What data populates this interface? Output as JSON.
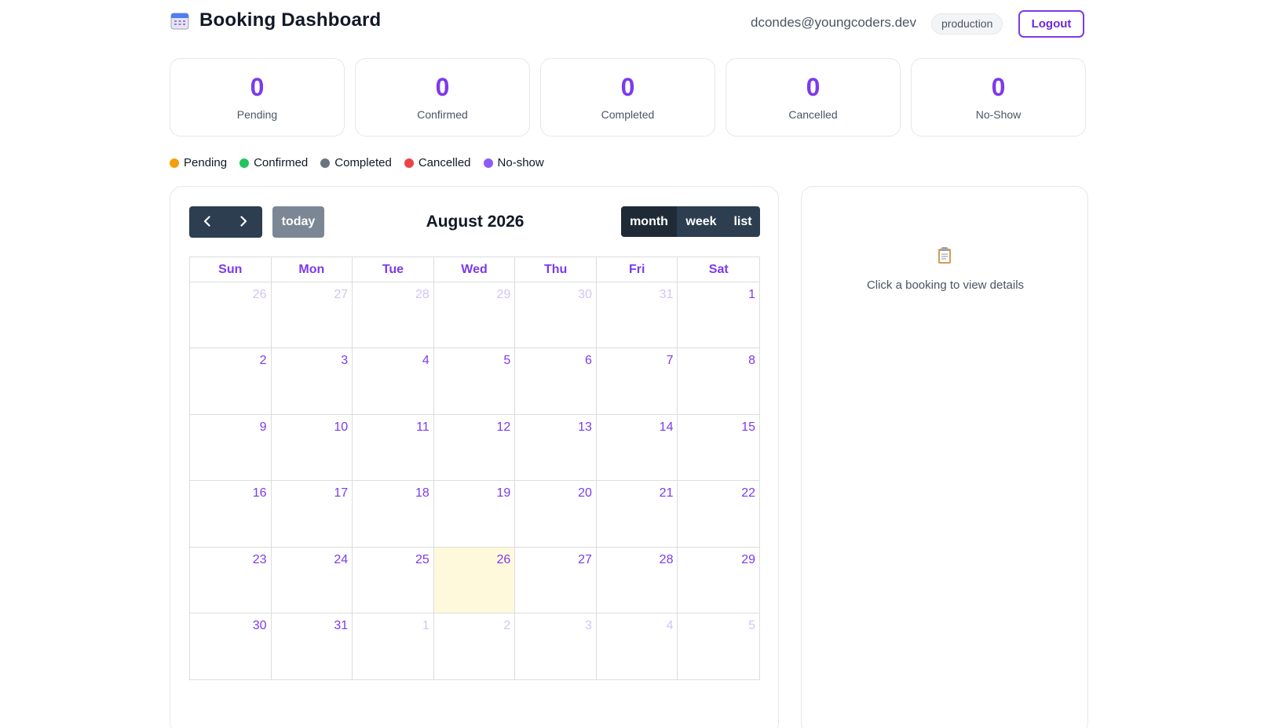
{
  "header": {
    "title": "Booking Dashboard",
    "logo_icon": "calendar-icon",
    "user_email": "dcondes@youngcoders.dev",
    "env_badge": "production",
    "logout_label": "Logout"
  },
  "stats": [
    {
      "value": "0",
      "label": "Pending"
    },
    {
      "value": "0",
      "label": "Confirmed"
    },
    {
      "value": "0",
      "label": "Completed"
    },
    {
      "value": "0",
      "label": "Cancelled"
    },
    {
      "value": "0",
      "label": "No-Show"
    }
  ],
  "legend": [
    {
      "label": "Pending",
      "color": "#f59e0b"
    },
    {
      "label": "Confirmed",
      "color": "#22c55e"
    },
    {
      "label": "Completed",
      "color": "#6b7280"
    },
    {
      "label": "Cancelled",
      "color": "#ef4444"
    },
    {
      "label": "No-show",
      "color": "#8b5cf6"
    }
  ],
  "calendar": {
    "title": "August 2026",
    "today_label": "today",
    "views": {
      "month": "month",
      "week": "week",
      "list": "list"
    },
    "active_view": "month",
    "weekdays": [
      "Sun",
      "Mon",
      "Tue",
      "Wed",
      "Thu",
      "Fri",
      "Sat"
    ],
    "weeks": [
      [
        {
          "d": "26",
          "m": true
        },
        {
          "d": "27",
          "m": true
        },
        {
          "d": "28",
          "m": true
        },
        {
          "d": "29",
          "m": true
        },
        {
          "d": "30",
          "m": true
        },
        {
          "d": "31",
          "m": true
        },
        {
          "d": "1"
        }
      ],
      [
        {
          "d": "2"
        },
        {
          "d": "3"
        },
        {
          "d": "4"
        },
        {
          "d": "5"
        },
        {
          "d": "6"
        },
        {
          "d": "7"
        },
        {
          "d": "8"
        }
      ],
      [
        {
          "d": "9"
        },
        {
          "d": "10"
        },
        {
          "d": "11"
        },
        {
          "d": "12"
        },
        {
          "d": "13"
        },
        {
          "d": "14"
        },
        {
          "d": "15"
        }
      ],
      [
        {
          "d": "16"
        },
        {
          "d": "17"
        },
        {
          "d": "18"
        },
        {
          "d": "19"
        },
        {
          "d": "20"
        },
        {
          "d": "21"
        },
        {
          "d": "22"
        }
      ],
      [
        {
          "d": "23"
        },
        {
          "d": "24"
        },
        {
          "d": "25"
        },
        {
          "d": "26",
          "today": true
        },
        {
          "d": "27"
        },
        {
          "d": "28"
        },
        {
          "d": "29"
        }
      ],
      [
        {
          "d": "30"
        },
        {
          "d": "31"
        },
        {
          "d": "1",
          "m": true
        },
        {
          "d": "2",
          "m": true
        },
        {
          "d": "3",
          "m": true
        },
        {
          "d": "4",
          "m": true
        },
        {
          "d": "5",
          "m": true
        }
      ]
    ]
  },
  "details": {
    "icon": "clipboard-icon",
    "hint": "Click a booking to view details"
  }
}
